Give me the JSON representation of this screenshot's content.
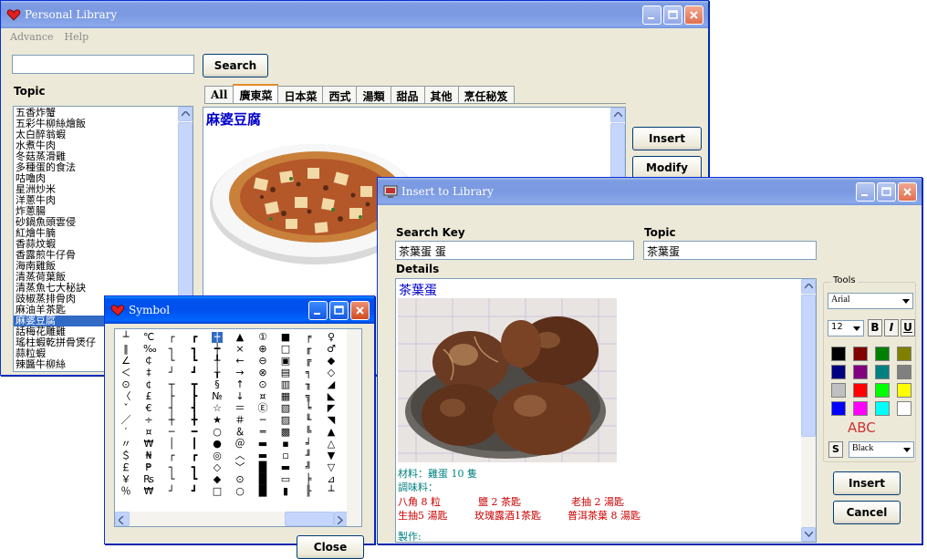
{
  "colors": {
    "title_active": "#0054e3",
    "title_inactive": "#7a96df",
    "selection": "#316ac5",
    "tab_highlight": "#e68b2c",
    "close_button": "#e0542a",
    "recipe_title": "#0000cc",
    "ingredient_main": "#008080",
    "ingredient_spice": "#cc0000"
  },
  "main_window": {
    "title": "Personal Library",
    "menu": [
      "Advance",
      "Help"
    ],
    "search_value": "",
    "search_button": "Search",
    "topic_label": "Topic",
    "topics": [
      "五香炸蟹",
      "五彩牛柳絲燴飯",
      "太白醉翁蝦",
      "水煮牛肉",
      "冬菇蒸滑雞",
      "多種蛋的食法",
      "咕嚕肉",
      "星洲炒米",
      "洋蔥牛肉",
      "炸蔥腸",
      "砂鍋魚頭雲侵",
      "紅燴牛腩",
      "香蒜炆蝦",
      "香露煎牛仔骨",
      "海南雞飯",
      "清蒸荷葉飯",
      "清蒸魚七大秘訣",
      "豉椒蒸排骨肉",
      "麻油羊茶匙",
      "麻婆豆腐",
      "話梅花雕雞",
      "瑤柱蝦乾拼骨煲仔",
      "蒜粒蝦",
      "辣醬牛柳絲"
    ],
    "selected_topic_index": 19,
    "tabs": [
      "All",
      "廣東菜",
      "日本菜",
      "西式",
      "湯類",
      "甜品",
      "其他",
      "烹任秘笈"
    ],
    "active_tab_index": 1,
    "recipe_title": "麻婆豆腐",
    "buttons": {
      "insert": "Insert",
      "modify": "Modify"
    }
  },
  "insert_window": {
    "title": "Insert to Library",
    "search_key_label": "Search Key",
    "search_key_value": "茶葉蛋 蛋",
    "topic_label": "Topic",
    "topic_value": "茶葉蛋",
    "details_label": "Details",
    "details_title": "茶葉蛋",
    "ingredients_line": "材料：雞蛋 10 隻",
    "seasoning_label": "調味料：",
    "seasonings": [
      [
        "八角 8 粒",
        "鹽 2 茶匙",
        "老抽 2 湯匙"
      ],
      [
        "生抽5 湯匙",
        "玫瑰露酒1茶匙",
        "普洱茶葉 8 湯匙"
      ]
    ],
    "method_label": "製作:",
    "tools": {
      "label": "Tools",
      "font": "Arial",
      "size": "12",
      "bold": "B",
      "italic": "I",
      "underline": "U",
      "swatches": [
        "#000000",
        "#800000",
        "#008000",
        "#808000",
        "#000080",
        "#800080",
        "#008080",
        "#808080",
        "#c0c0c0",
        "#ff0000",
        "#00ff00",
        "#ffff00",
        "#0000ff",
        "#ff00ff",
        "#00ffff",
        "#ffffff"
      ],
      "sample_text": "ABC",
      "sample_color": "#cc3333",
      "s_button": "S",
      "color_name": "Black"
    },
    "buttons": {
      "insert": "Insert",
      "cancel": "Cancel"
    }
  },
  "symbol_window": {
    "title": "Symbol",
    "columns": [
      [
        "┴",
        "‖",
        "∠",
        "＜",
        "⊙",
        "〈",
        "ˇ",
        "／",
        "′",
        "〃",
        "＄",
        "￡",
        "￥",
        "％"
      ],
      [
        "℃",
        "‰",
        "￠",
        "‡",
        "¢",
        "£",
        "€",
        "÷",
        "¤",
        "₩",
        "₦",
        "₱",
        "₨",
        "₩"
      ],
      [
        "┌",
        "┐",
        "└",
        "┘",
        "┬",
        "├",
        "┤",
        "┼",
        "─",
        "│",
        "┌",
        "┐",
        "└",
        "┘"
      ],
      [
        "┏",
        "┓",
        "┗",
        "┛",
        "┳",
        "┣",
        "┫",
        "╋",
        "━",
        "┃",
        "┏",
        "┓",
        "┗",
        "┛"
      ],
      [
        "┼",
        "┿",
        "╀",
        "╁",
        "§",
        "№",
        "☆",
        "★",
        "○",
        "●",
        "◎",
        "◇",
        "◆",
        "□"
      ],
      [
        "▲",
        "×",
        "←",
        "→",
        "↑",
        "↓",
        "＝",
        "＃",
        "＆",
        "＠",
        "︿",
        "﹀",
        "⊙",
        "○"
      ],
      [
        "①",
        "⊕",
        "⊖",
        "⊗",
        "⊙",
        "¤",
        "Ⓔ",
        "─",
        "═",
        "▬",
        "▬",
        "█",
        "█",
        "█"
      ],
      [
        "■",
        "□",
        "▣",
        "▤",
        "▥",
        "▦",
        "▧",
        "▨",
        "▩",
        "▪",
        "▫",
        "▬",
        "▭",
        "▮"
      ],
      [
        "╒",
        "╓",
        "╔",
        "╕",
        "╖",
        "╗",
        "╘",
        "╙",
        "╚",
        "╛",
        "╜",
        "╝",
        "╞",
        "╟"
      ],
      [
        "♀",
        "♂",
        "◆",
        "◇",
        "◢",
        "◣",
        "◤",
        "◥",
        "▲",
        "△",
        "▼",
        "▽",
        "⊿",
        "┴"
      ]
    ],
    "close_button": "Close"
  }
}
